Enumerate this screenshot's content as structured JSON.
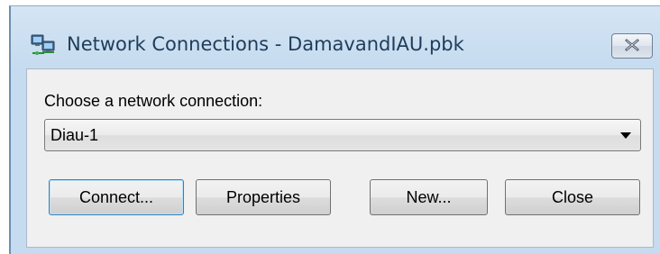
{
  "window": {
    "title": "Network Connections - DamavandIAU.pbk",
    "icon": "network-connections-icon",
    "close_icon": "close-x-icon"
  },
  "dialog": {
    "prompt_label": "Choose a network connection:",
    "connection_select": {
      "selected_value": "Diau-1"
    },
    "buttons": {
      "connect": "Connect...",
      "properties": "Properties",
      "new": "New...",
      "close": "Close"
    }
  }
}
